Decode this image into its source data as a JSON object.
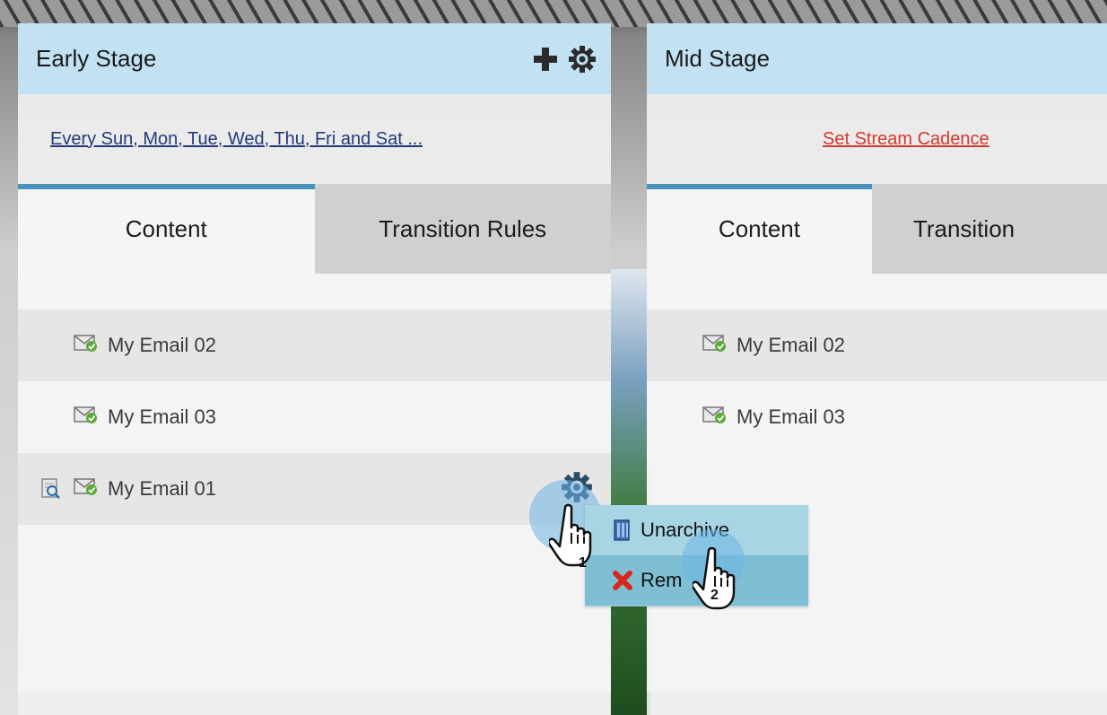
{
  "panels": {
    "early": {
      "title": "Early Stage",
      "cadence": "Every Sun, Mon, Tue, Wed, Thu, Fri and Sat ...",
      "tabs": [
        "Content",
        "Transition Rules"
      ],
      "items": [
        "My Email 02",
        "My Email 03",
        "My Email 01"
      ]
    },
    "mid": {
      "title": "Mid Stage",
      "cadence": "Set Stream Cadence",
      "tabs": [
        "Content",
        "Transition"
      ],
      "items": [
        "My Email 02",
        "My Email 03"
      ]
    }
  },
  "context_menu": {
    "items": [
      "Unarchive",
      "Rem"
    ]
  },
  "cursor_steps": [
    "1",
    "2"
  ],
  "icons": {
    "add": "plus-icon",
    "settings": "gear-icon",
    "email": "email-icon",
    "preview": "preview-icon",
    "unarchive": "unarchive-icon",
    "remove": "remove-icon"
  },
  "colors": {
    "header_bg": "#bee1f3",
    "tab_active_border": "#4a93bf",
    "cadence_link": "#243a78",
    "cadence_unset": "#d23a2e",
    "menu_bg": "#a7d5e3",
    "menu_hover": "#7fbfd3"
  }
}
